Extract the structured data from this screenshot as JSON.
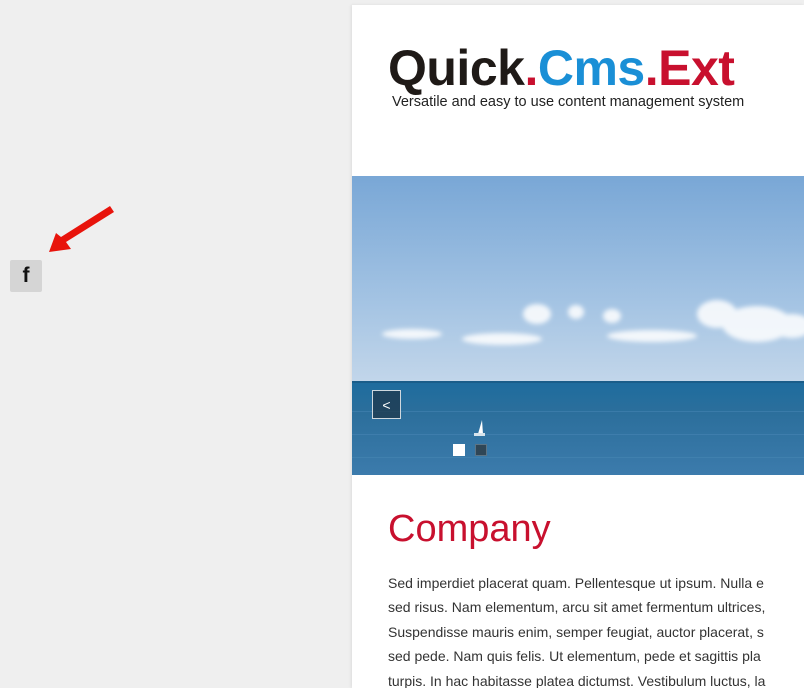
{
  "logo": {
    "part1": "Quick",
    "dot1": ".",
    "part2": "Cms",
    "dot2": ".",
    "part3": "Ext"
  },
  "tagline": "Versatile and easy to use content management system",
  "slider": {
    "prev_label": "<",
    "dots": [
      "slide-1",
      "slide-2"
    ],
    "active_dot": 0
  },
  "content": {
    "heading": "Company",
    "lines": [
      "Sed imperdiet placerat quam. Pellentesque ut ipsum. Nulla e",
      "sed risus. Nam elementum, arcu sit amet fermentum ultrices,",
      "Suspendisse mauris enim, semper feugiat, auctor placerat, s",
      "sed pede. Nam quis felis. Ut elementum, pede et sagittis pla",
      "turpis. In hac habitasse platea dictumst. Vestibulum luctus, la"
    ]
  },
  "social": {
    "facebook_glyph": "f",
    "facebook_icon": "facebook-icon"
  },
  "annotation": {
    "arrow_color": "#e8140c"
  },
  "colors": {
    "brand_dark": "#1f1a17",
    "brand_blue": "#1a8fd6",
    "brand_red": "#c8102e"
  }
}
